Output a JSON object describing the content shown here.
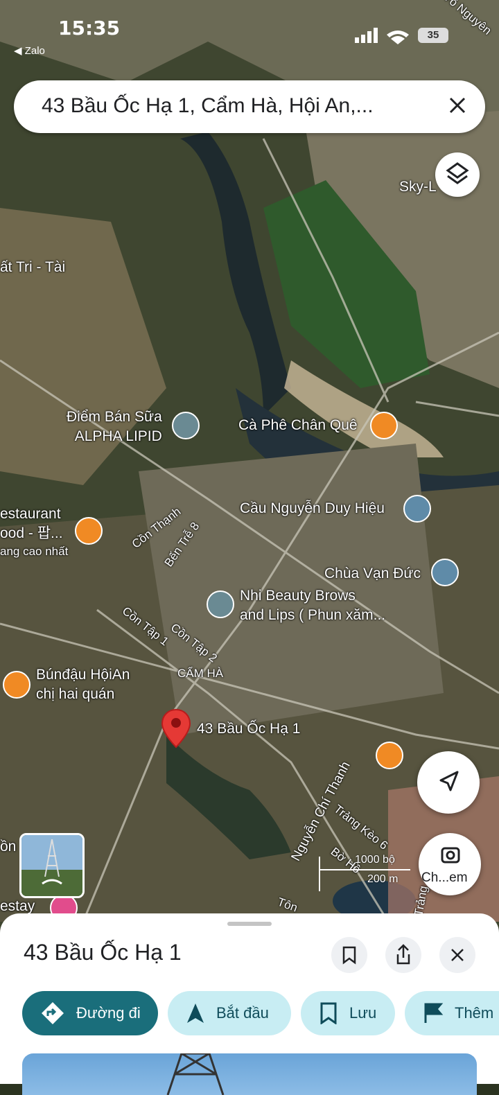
{
  "status_bar": {
    "time": "15:35",
    "back_app": "◀ Zalo",
    "battery": "35"
  },
  "search": {
    "query": "43 Bầu Ốc Hạ 1, Cẩm Hà, Hội An,...",
    "close_icon": "close-icon"
  },
  "map": {
    "places": [
      {
        "text": "Sky-L",
        "icon": "none"
      },
      {
        "text": "ất Tri - Tài",
        "icon": "none"
      },
      {
        "text": "Điểm Bán Sữa\nALPHA LIPID",
        "icon": "place-pin-icon"
      },
      {
        "text": "Cà Phê Chân Quê",
        "icon": "cafe-icon"
      },
      {
        "text": "Cầu Nguyễn Duy Hiệu",
        "icon": "bridge-icon"
      },
      {
        "text": "estaurant\nood - 팝...",
        "icon": "restaurant-icon"
      },
      {
        "text": "ang cao nhất",
        "icon": "none"
      },
      {
        "text": "Chùa Vạn Đức",
        "icon": "temple-icon"
      },
      {
        "text": "Nhi Beauty Brows\nand Lips ( Phun xăm...",
        "icon": "place-pin-icon"
      },
      {
        "text": "Búnđậu HộiAn\nchị hai quán",
        "icon": "restaurant-icon"
      },
      {
        "text": "CẨM HÀ",
        "icon": "none"
      },
      {
        "text": "43 Bầu Ốc Hạ 1",
        "icon": "red-pin-icon"
      },
      {
        "text": "ồn",
        "icon": "none"
      },
      {
        "text": "estay",
        "icon": "hotel-icon"
      }
    ],
    "roads": [
      "Cồn Thạnh",
      "Bến Trễ 8",
      "Cồn Tập 1",
      "Cồn Tập 2",
      "Nguyễn Chí Thanh",
      "Trảng Kèo 6",
      "Bờ Hồ",
      "Tôn",
      "Trảng",
      "Võ Nguyên"
    ],
    "scale": {
      "feet": "1000 bộ",
      "meters": "200 m"
    },
    "lens_label": "Ch...em"
  },
  "sheet": {
    "title": "43 Bầu Ốc Hạ 1",
    "actions": [
      {
        "label": "Đường đi",
        "icon": "directions-icon"
      },
      {
        "label": "Bắt đầu",
        "icon": "navigation-arrow-icon"
      },
      {
        "label": "Lưu",
        "icon": "bookmark-icon"
      },
      {
        "label": "Thêm",
        "icon": "flag-icon"
      }
    ]
  }
}
